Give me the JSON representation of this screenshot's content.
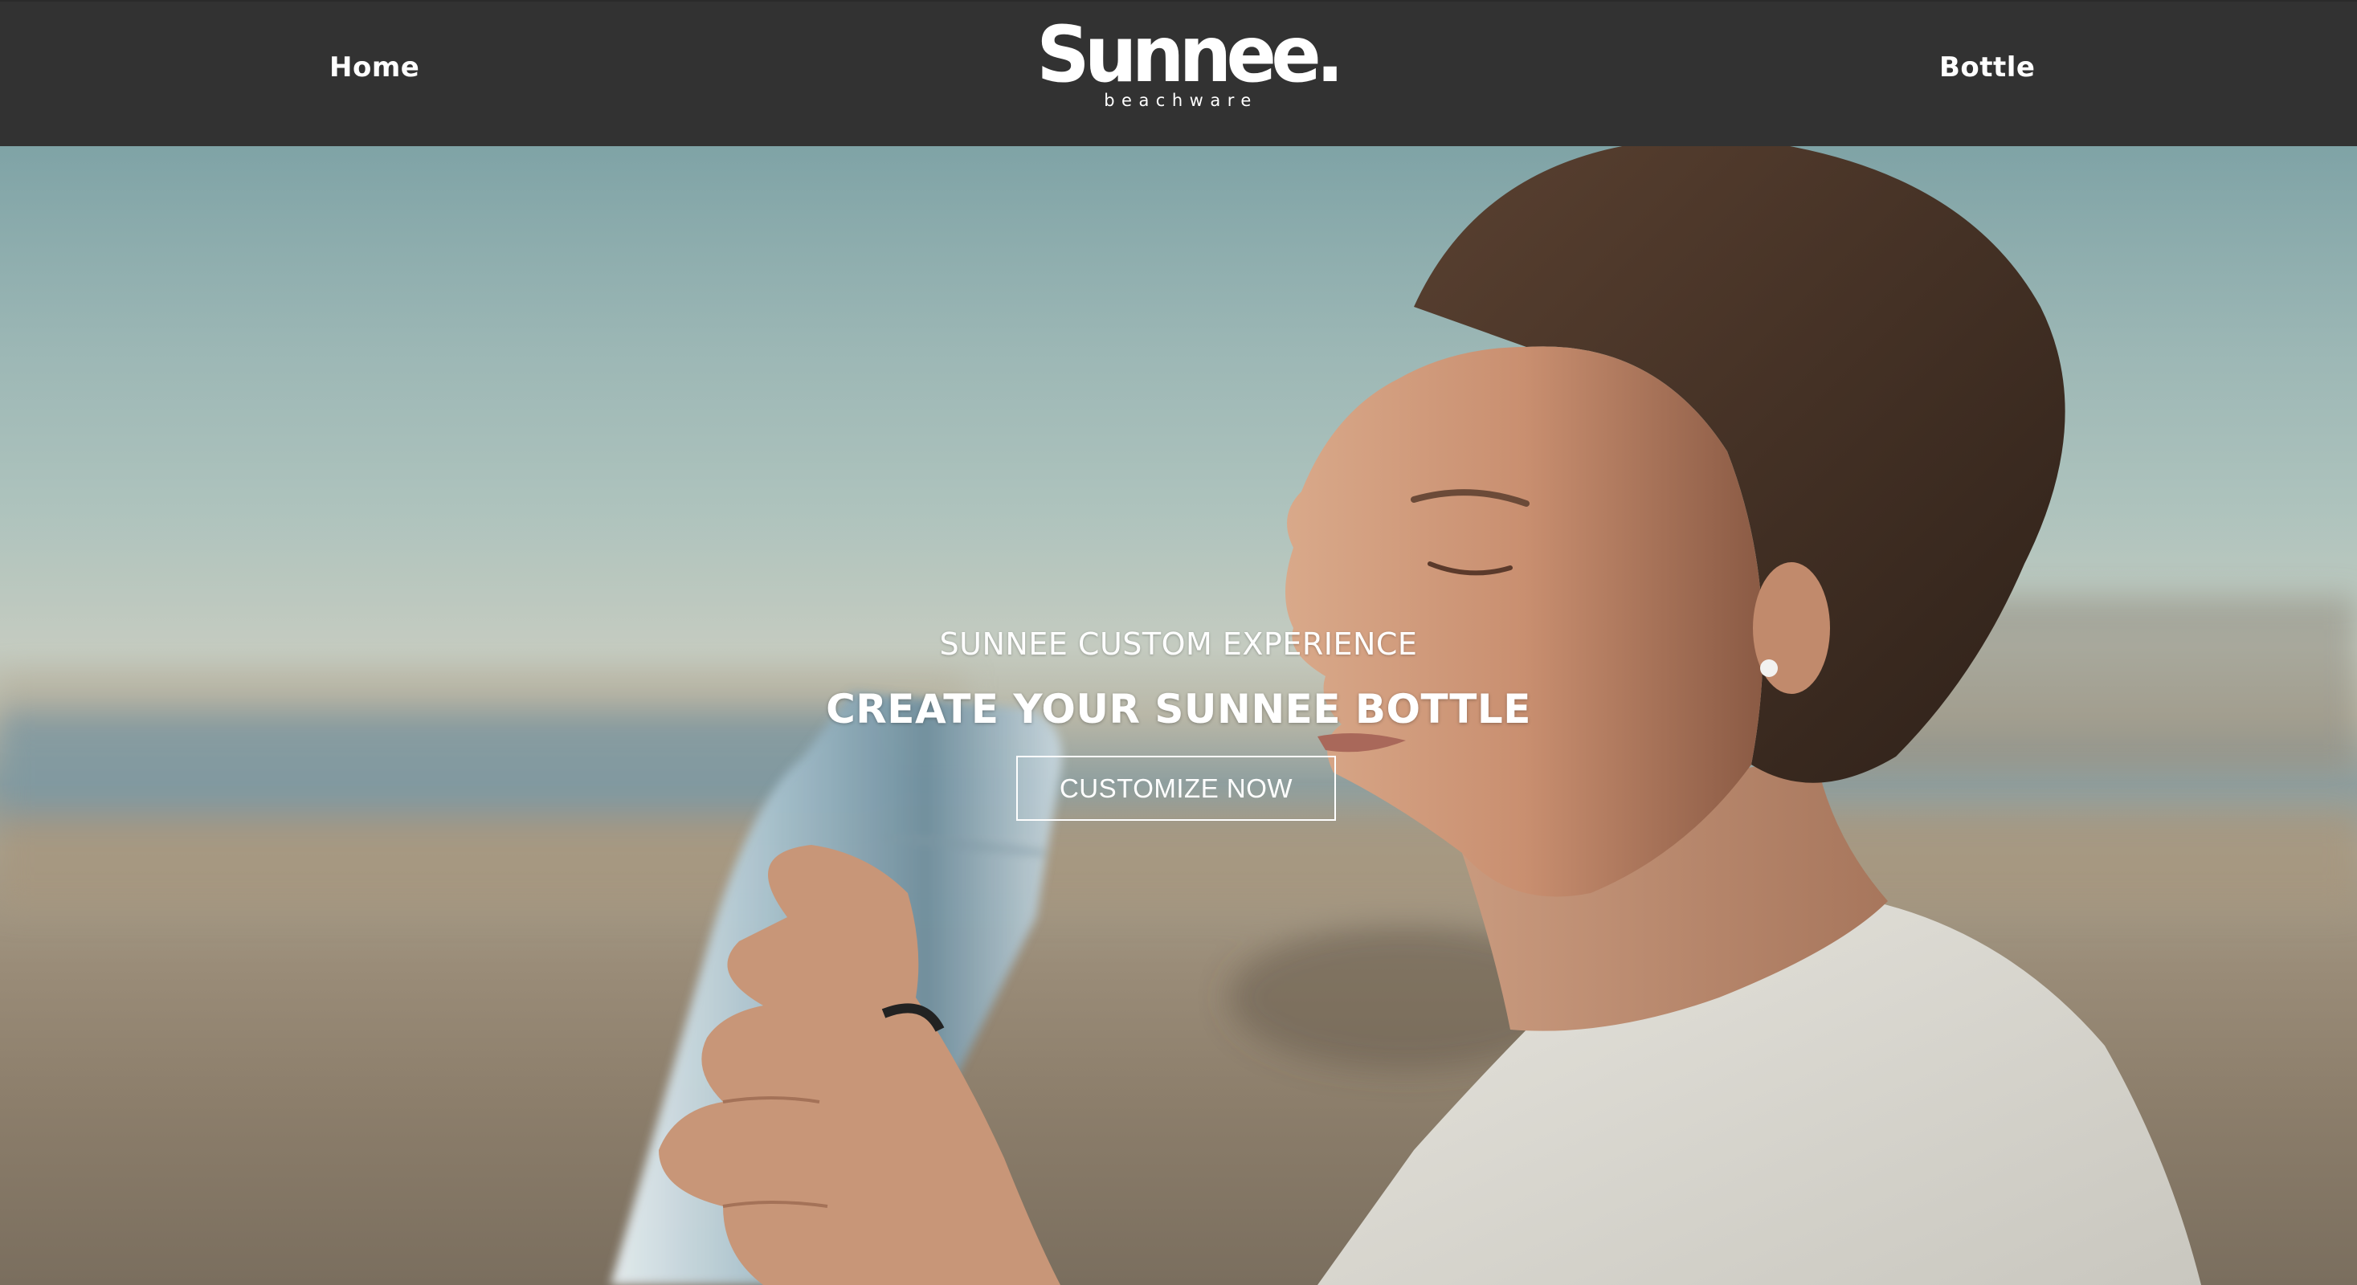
{
  "header": {
    "nav_left_label": "Home",
    "nav_right_label": "Bottle",
    "logo": {
      "wordmark": "Sunnee.",
      "tagline": "beachware"
    },
    "background_color": "#323232"
  },
  "hero": {
    "eyebrow": "SUNNEE CUSTOM EXPERIENCE",
    "title": "CREATE YOUR SUNNEE BOTTLE",
    "cta_label": "CUSTOMIZE NOW",
    "image_subject": "woman-drinking-from-bottle-on-beach"
  },
  "colors": {
    "text": "#ffffff",
    "sky": "#9cb7b5",
    "sand": "#9a8c78"
  }
}
